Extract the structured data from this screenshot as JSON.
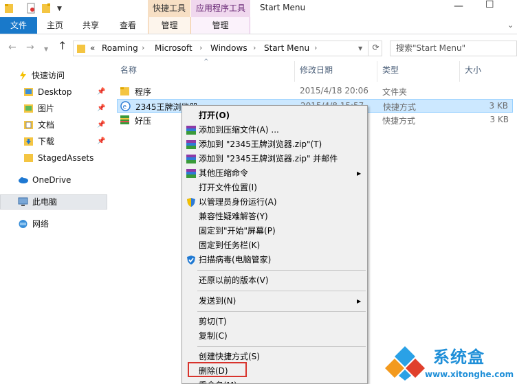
{
  "titlebar": {
    "context_tab_shortcut": "快捷工具",
    "context_tab_apptools": "应用程序工具",
    "window_title": "Start Menu"
  },
  "ribbon": {
    "file_tab": "文件",
    "tabs": [
      "主页",
      "共享",
      "查看"
    ],
    "manage_shortcut": "管理",
    "manage_app": "管理"
  },
  "address": {
    "overflow": "«",
    "crumbs": [
      "Roaming",
      "Microsoft",
      "Windows",
      "Start Menu"
    ],
    "search_placeholder": "搜索\"Start Menu\""
  },
  "nav": {
    "quick_access": "快速访问",
    "items": [
      "Desktop",
      "图片",
      "文档",
      "下载",
      "StagedAssets"
    ],
    "onedrive": "OneDrive",
    "this_pc": "此电脑",
    "network": "网络"
  },
  "columns": {
    "name": "名称",
    "date": "修改日期",
    "type": "类型",
    "size": "大小"
  },
  "files": [
    {
      "name": "程序",
      "date": "2015/4/18 20:06",
      "type": "文件夹",
      "size": ""
    },
    {
      "name": "2345王牌浏览器",
      "date": "2015/4/8 15:57",
      "type": "快捷方式",
      "size": "3 KB"
    },
    {
      "name": "好压",
      "date": "",
      "type": "快捷方式",
      "size": "3 KB"
    }
  ],
  "menu": {
    "open": "打开(O)",
    "add_archive": "添加到压缩文件(A) ...",
    "add_zip": "添加到 \"2345王牌浏览器.zip\"(T)",
    "add_zip_mail": "添加到 \"2345王牌浏览器.zip\" 并邮件",
    "other_compress": "其他压缩命令",
    "open_location": "打开文件位置(I)",
    "run_admin": "以管理员身份运行(A)",
    "troubleshoot": "兼容性疑难解答(Y)",
    "pin_start": "固定到\"开始\"屏幕(P)",
    "pin_taskbar": "固定到任务栏(K)",
    "scan_virus": "扫描病毒(电脑管家)",
    "restore_prev": "还原以前的版本(V)",
    "send_to": "发送到(N)",
    "cut": "剪切(T)",
    "copy": "复制(C)",
    "create_shortcut": "创建快捷方式(S)",
    "delete": "删除(D)",
    "rename": "重命名(M)"
  },
  "watermark": {
    "text": "系统盒",
    "url": "www.xitonghe.com"
  }
}
